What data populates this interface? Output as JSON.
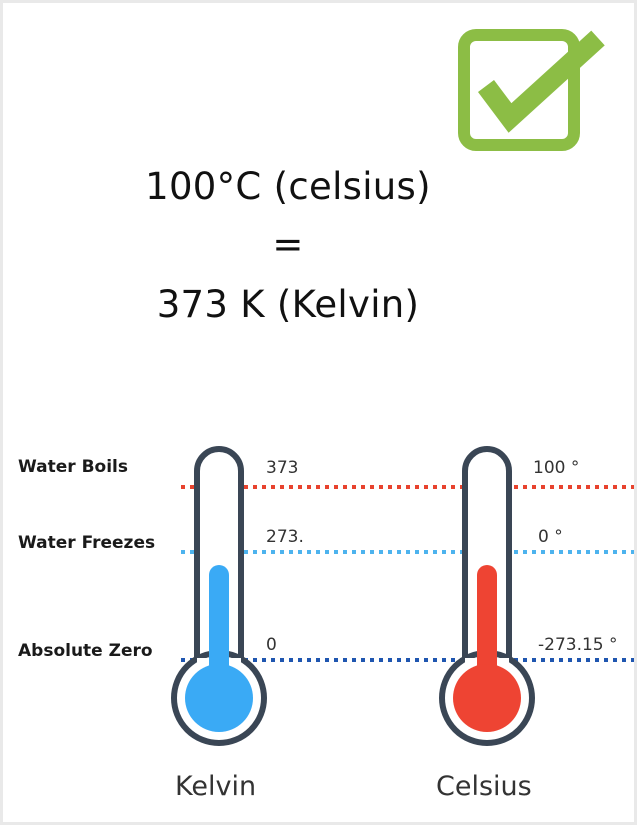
{
  "equation": {
    "line1": "100°C (celsius)",
    "line2": "=",
    "line3": "373 K (Kelvin)"
  },
  "levels": [
    {
      "label": "Water Boils",
      "kelvin": "373",
      "celsius": "100 °",
      "color": "#e8432e"
    },
    {
      "label": "Water Freezes",
      "kelvin": "273.",
      "celsius": "0 °",
      "color": "#4db3ee"
    },
    {
      "label": "Absolute Zero",
      "kelvin": "0",
      "celsius": "-273.15 °",
      "color": "#1f56b0"
    }
  ],
  "thermometers": [
    {
      "name": "Kelvin",
      "fill_color": "#3aaaf5"
    },
    {
      "name": "Celsius",
      "fill_color": "#ee4433"
    }
  ],
  "icon": {
    "name": "checkmark-box-icon",
    "color": "#8cbd45"
  }
}
